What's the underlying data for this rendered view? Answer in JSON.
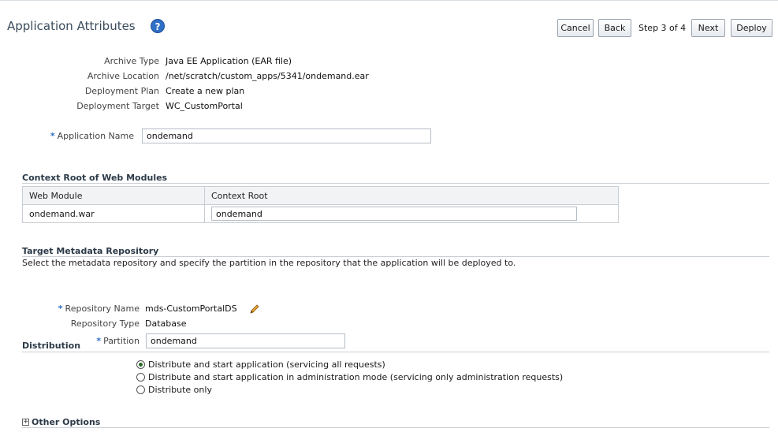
{
  "header": {
    "title": "Application Attributes",
    "help_icon_glyph": "?",
    "buttons": {
      "cancel": "Cancel",
      "back": "Back",
      "next": "Next",
      "deploy": "Deploy"
    },
    "step": "Step 3 of 4"
  },
  "summary": {
    "archive_type_label": "Archive Type",
    "archive_type_value": "Java EE Application (EAR file)",
    "archive_location_label": "Archive Location",
    "archive_location_value": "/net/scratch/custom_apps/5341/ondemand.ear",
    "deployment_plan_label": "Deployment Plan",
    "deployment_plan_value": "Create a new plan",
    "deployment_target_label": "Deployment Target",
    "deployment_target_value": "WC_CustomPortal"
  },
  "application_name": {
    "required_mark": "*",
    "label": "Application Name",
    "value": "ondemand"
  },
  "context_root": {
    "title": "Context Root of Web Modules",
    "columns": [
      "Web Module",
      "Context Root"
    ],
    "rows": [
      {
        "module": "ondemand.war",
        "root": "ondemand"
      }
    ]
  },
  "metadata": {
    "title": "Target Metadata Repository",
    "description": "Select the metadata repository and specify the partition in the repository that the application will be deployed to.",
    "repository_name_label": "Repository Name",
    "repository_name_value": "mds-CustomPortalDS",
    "repository_type_label": "Repository Type",
    "repository_type_value": "Database",
    "partition_label": "Partition",
    "partition_value": "ondemand",
    "required_mark": "*"
  },
  "distribution": {
    "title": "Distribution",
    "options": [
      {
        "label": "Distribute and start application (servicing all requests)",
        "selected": true
      },
      {
        "label": "Distribute and start application in administration mode (servicing only administration requests)",
        "selected": false
      },
      {
        "label": "Distribute only",
        "selected": false
      }
    ]
  },
  "other_options": {
    "title": "Other Options",
    "expander_glyph": "+"
  },
  "colors": {
    "accent": "#2f6fc6",
    "section_text": "#2b3a48",
    "border": "#c9ced4"
  }
}
